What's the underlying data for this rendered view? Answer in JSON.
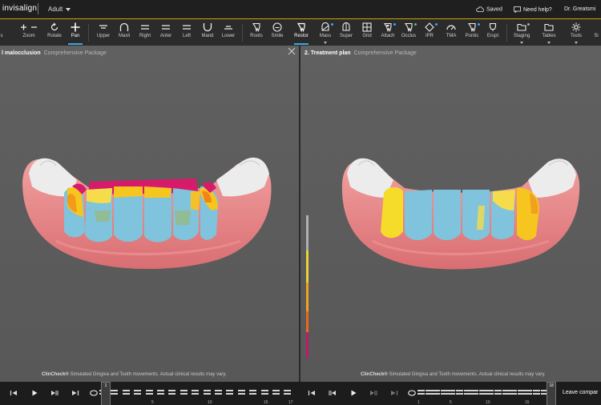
{
  "header": {
    "brand": "invisalign",
    "mode": "Adult",
    "saved": "Saved",
    "help": "Need help?",
    "user": "Dr. Greatsmi"
  },
  "toolbar": {
    "items": [
      {
        "label": "s",
        "icon": "partial-tool-icon"
      },
      {
        "label": "Zoom",
        "icon": "zoom-icon"
      },
      {
        "label": "Rotate",
        "icon": "rotate-icon"
      },
      {
        "label": "Pan",
        "icon": "pan-icon",
        "active": true
      },
      {
        "label": "Upper",
        "icon": "upper-arch-icon"
      },
      {
        "label": "Maxil",
        "icon": "maxillary-icon"
      },
      {
        "label": "Right",
        "icon": "right-view-icon"
      },
      {
        "label": "Anter",
        "icon": "anterior-view-icon"
      },
      {
        "label": "Left",
        "icon": "left-view-icon"
      },
      {
        "label": "Mand",
        "icon": "mandibular-icon"
      },
      {
        "label": "Lower",
        "icon": "lower-arch-icon"
      },
      {
        "label": "Roots",
        "icon": "roots-icon"
      },
      {
        "label": "Smile",
        "icon": "smile-icon"
      },
      {
        "label": "Restor",
        "icon": "restoration-icon",
        "active": true
      },
      {
        "label": "Mass",
        "icon": "mass-icon"
      },
      {
        "label": "Super",
        "icon": "superimpose-icon"
      },
      {
        "label": "Grid",
        "icon": "grid-icon"
      },
      {
        "label": "Attach",
        "icon": "attachment-icon"
      },
      {
        "label": "Occlus",
        "icon": "occlusion-icon"
      },
      {
        "label": "IPR",
        "icon": "ipr-icon"
      },
      {
        "label": "TMA",
        "icon": "tma-icon"
      },
      {
        "label": "Pontic",
        "icon": "pontic-icon"
      },
      {
        "label": "Erupt",
        "icon": "eruption-icon"
      },
      {
        "label": "Staging",
        "icon": "staging-icon"
      },
      {
        "label": "Tables",
        "icon": "tables-icon"
      },
      {
        "label": "Tools",
        "icon": "tools-icon"
      },
      {
        "label": "Si",
        "icon": "partial-tool-icon"
      }
    ]
  },
  "panes": {
    "left": {
      "title": "l malocclusion",
      "subtitle": "Comprehensive Package"
    },
    "right": {
      "title": "2. Treatment plan",
      "subtitle": "Comprehensive Package"
    }
  },
  "disclaimer": {
    "brand": "ClinCheck®",
    "text": "Simulated Gingiva and Tooth movements. Actual clinical results may vary."
  },
  "legend_colors": [
    "#b0b0b0",
    "#e8d23a",
    "#f0a21e",
    "#e96a1a",
    "#c01a6a"
  ],
  "timeline": {
    "left": {
      "current_stage": "1",
      "ticks": [
        "5",
        "10",
        "15",
        "17"
      ]
    },
    "right": {
      "current_stage": "18",
      "ticks": [
        "1",
        "5",
        "10",
        "15"
      ]
    },
    "leave": "Leave compar"
  }
}
